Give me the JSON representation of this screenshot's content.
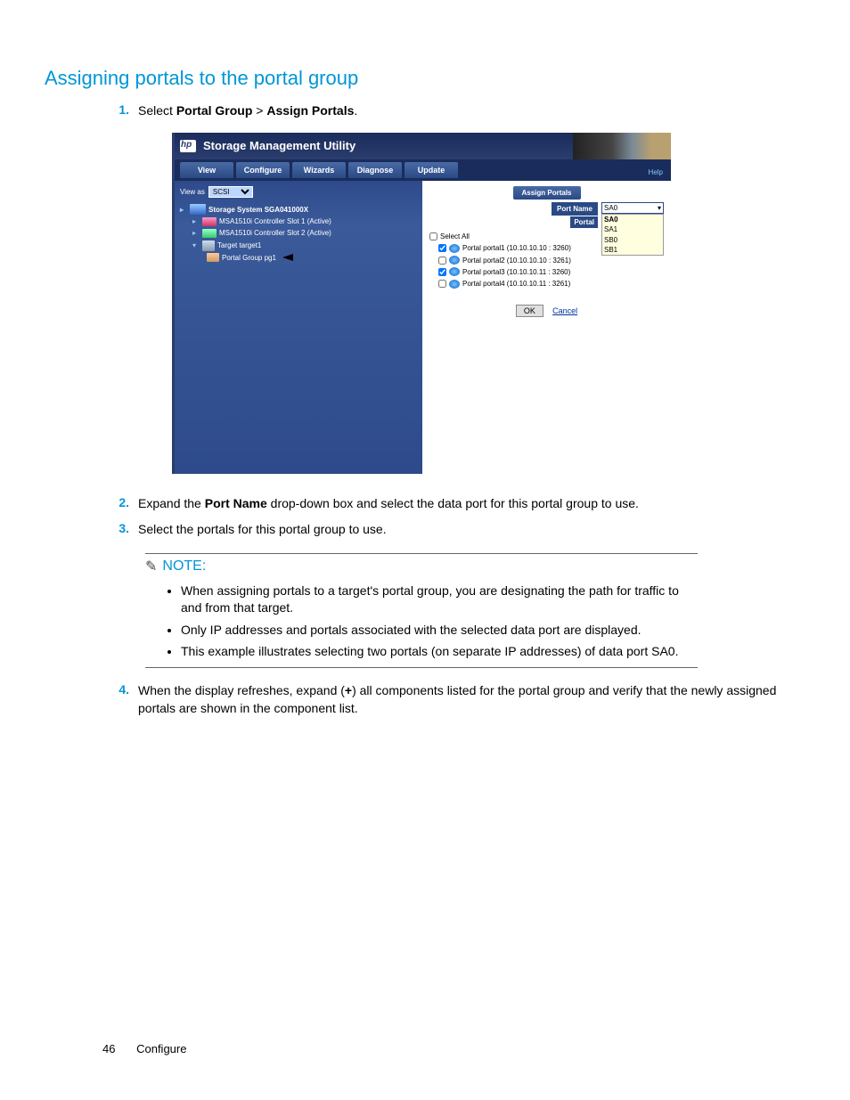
{
  "section_title": "Assigning portals to the portal group",
  "steps": {
    "s1": {
      "num": "1.",
      "prefix": "Select ",
      "b1": "Portal Group",
      "sep": " > ",
      "b2": "Assign Portals",
      "suffix": "."
    },
    "s2": {
      "num": "2.",
      "prefix": "Expand the ",
      "b1": "Port Name",
      "suffix": " drop-down box and select the data port for this portal group to use."
    },
    "s3": {
      "num": "3.",
      "text": "Select the portals for this portal group to use."
    },
    "s4": {
      "num": "4.",
      "prefix": "When the display refreshes, expand (",
      "b1": "+",
      "suffix": ") all components listed for the portal group and verify that the newly assigned portals are shown in the component list."
    }
  },
  "note": {
    "title": "NOTE:",
    "items": [
      "When assigning portals to a target's portal group, you are designating the path for traffic to and from that target.",
      "Only IP addresses and portals associated with the selected data port are displayed.",
      "This example illustrates selecting two portals (on separate IP addresses) of data port SA0."
    ]
  },
  "app": {
    "title": "Storage Management Utility",
    "menu": [
      "View",
      "Configure",
      "Wizards",
      "Diagnose",
      "Update"
    ],
    "help": "Help",
    "viewas_label": "View as",
    "viewas_value": "SCSI",
    "tree": {
      "sys": "Storage System SGA041000X",
      "c1": "MSA1510i Controller Slot 1 (Active)",
      "c2": "MSA1510i Controller Slot 2 (Active)",
      "tgt": "Target target1",
      "pg": "Portal Group pg1"
    },
    "right": {
      "assign_btn": "Assign Portals",
      "portname_lbl": "Port Name",
      "portal_lbl": "Portal",
      "dd_selected": "SA0",
      "dd_opts": [
        "SA0",
        "SA1",
        "SB0",
        "SB1"
      ],
      "select_all": "Select All",
      "portals": [
        {
          "checked": true,
          "label": "Portal portal1 (10.10.10.10 : 3260)"
        },
        {
          "checked": false,
          "label": "Portal portal2 (10.10.10.10 : 3261)"
        },
        {
          "checked": true,
          "label": "Portal portal3 (10.10.10.11 : 3260)"
        },
        {
          "checked": false,
          "label": "Portal portal4 (10.10.10.11 : 3261)"
        }
      ],
      "ok": "OK",
      "cancel": "Cancel"
    }
  },
  "footer": {
    "page": "46",
    "section": "Configure"
  }
}
